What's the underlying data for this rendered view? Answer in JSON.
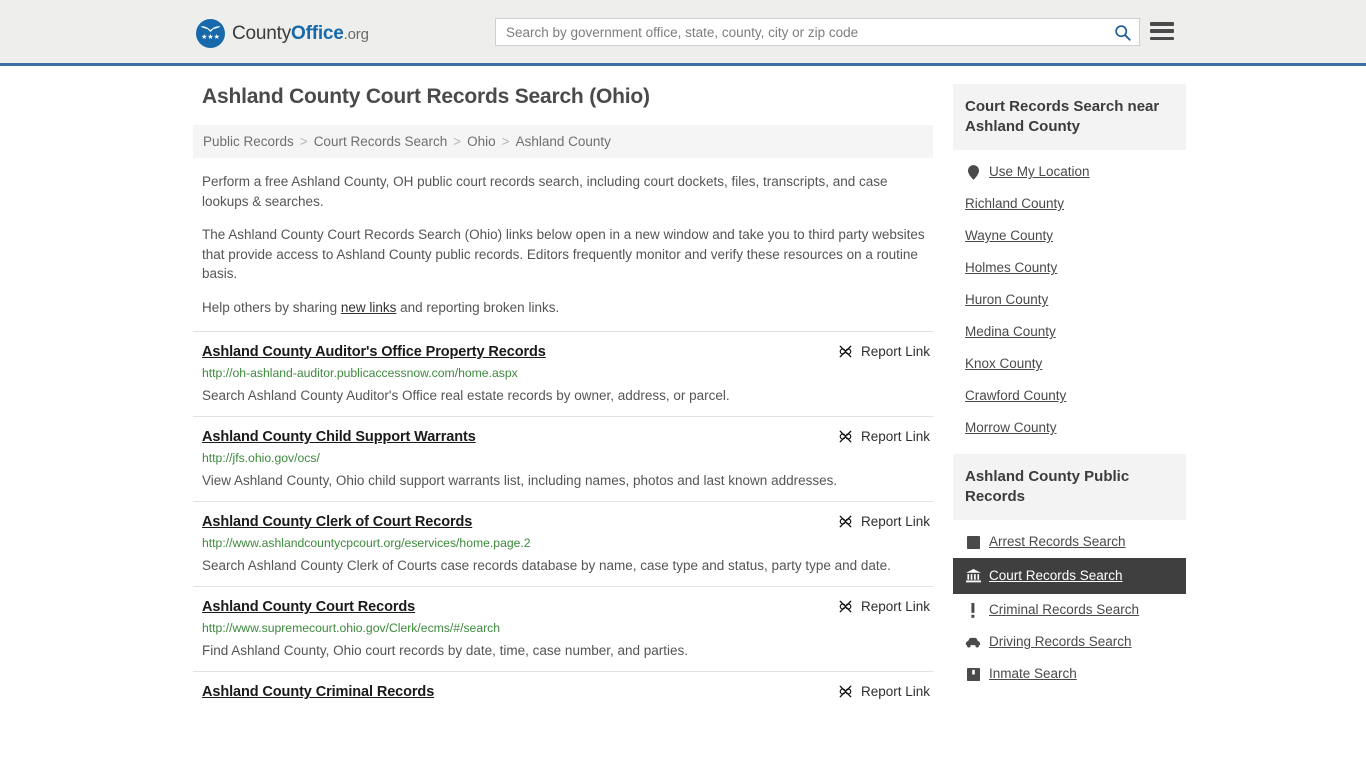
{
  "header": {
    "logo": {
      "part1": "County",
      "part2": "Office",
      "part3": ".org",
      "icon": "eagle-shield-icon"
    },
    "search": {
      "placeholder": "Search by government office, state, county, city or zip code",
      "value": "",
      "icon": "search-icon"
    },
    "menu_icon": "hamburger-menu-icon",
    "accent_color": "#3a6ea5"
  },
  "main": {
    "title": "Ashland County Court Records Search (Ohio)",
    "breadcrumb": [
      {
        "label": "Public Records"
      },
      {
        "label": "Court Records Search"
      },
      {
        "label": "Ohio"
      },
      {
        "label": "Ashland County"
      }
    ],
    "breadcrumb_separator": ">",
    "intro": {
      "p1": "Perform a free Ashland County, OH public court records search, including court dockets, files, transcripts, and case lookups & searches.",
      "p2": "The Ashland County Court Records Search (Ohio) links below open in a new window and take you to third party websites that provide access to Ashland County public records. Editors frequently monitor and verify these resources on a routine basis.",
      "p3_before": "Help others by sharing ",
      "p3_link": "new links",
      "p3_after": " and reporting broken links."
    },
    "report_link_label": "Report Link",
    "report_link_icon": "broken-link-icon",
    "results": [
      {
        "title": "Ashland County Auditor's Office Property Records",
        "url": "http://oh-ashland-auditor.publicaccessnow.com/home.aspx",
        "description": "Search Ashland County Auditor's Office real estate records by owner, address, or parcel."
      },
      {
        "title": "Ashland County Child Support Warrants",
        "url": "http://jfs.ohio.gov/ocs/",
        "description": "View Ashland County, Ohio child support warrants list, including names, photos and last known addresses."
      },
      {
        "title": "Ashland County Clerk of Court Records",
        "url": "http://www.ashlandcountycpcourt.org/eservices/home.page.2",
        "description": "Search Ashland County Clerk of Courts case records database by name, case type and status, party type and date."
      },
      {
        "title": "Ashland County Court Records",
        "url": "http://www.supremecourt.ohio.gov/Clerk/ecms/#/search",
        "description": "Find Ashland County, Ohio court records by date, time, case number, and parties."
      },
      {
        "title": "Ashland County Criminal Records",
        "url": "",
        "description": ""
      }
    ]
  },
  "sidebar": {
    "nearby": {
      "heading": "Court Records Search near Ashland County",
      "items": [
        {
          "label": "Use My Location",
          "icon": "location-pin-icon"
        },
        {
          "label": "Richland County",
          "icon": ""
        },
        {
          "label": "Wayne County",
          "icon": ""
        },
        {
          "label": "Holmes County",
          "icon": ""
        },
        {
          "label": "Huron County",
          "icon": ""
        },
        {
          "label": "Medina County",
          "icon": ""
        },
        {
          "label": "Knox County",
          "icon": ""
        },
        {
          "label": "Crawford County",
          "icon": ""
        },
        {
          "label": "Morrow County",
          "icon": ""
        }
      ]
    },
    "public_records": {
      "heading": "Ashland County Public Records",
      "items": [
        {
          "label": "Arrest Records Search",
          "icon": "fingerprint-icon",
          "active": false
        },
        {
          "label": "Court Records Search",
          "icon": "courthouse-icon",
          "active": true
        },
        {
          "label": "Criminal Records Search",
          "icon": "exclamation-icon",
          "active": false
        },
        {
          "label": "Driving Records Search",
          "icon": "car-icon",
          "active": false
        },
        {
          "label": "Inmate Search",
          "icon": "jail-icon",
          "active": false
        }
      ]
    },
    "active_color": "#3f3f3f"
  }
}
